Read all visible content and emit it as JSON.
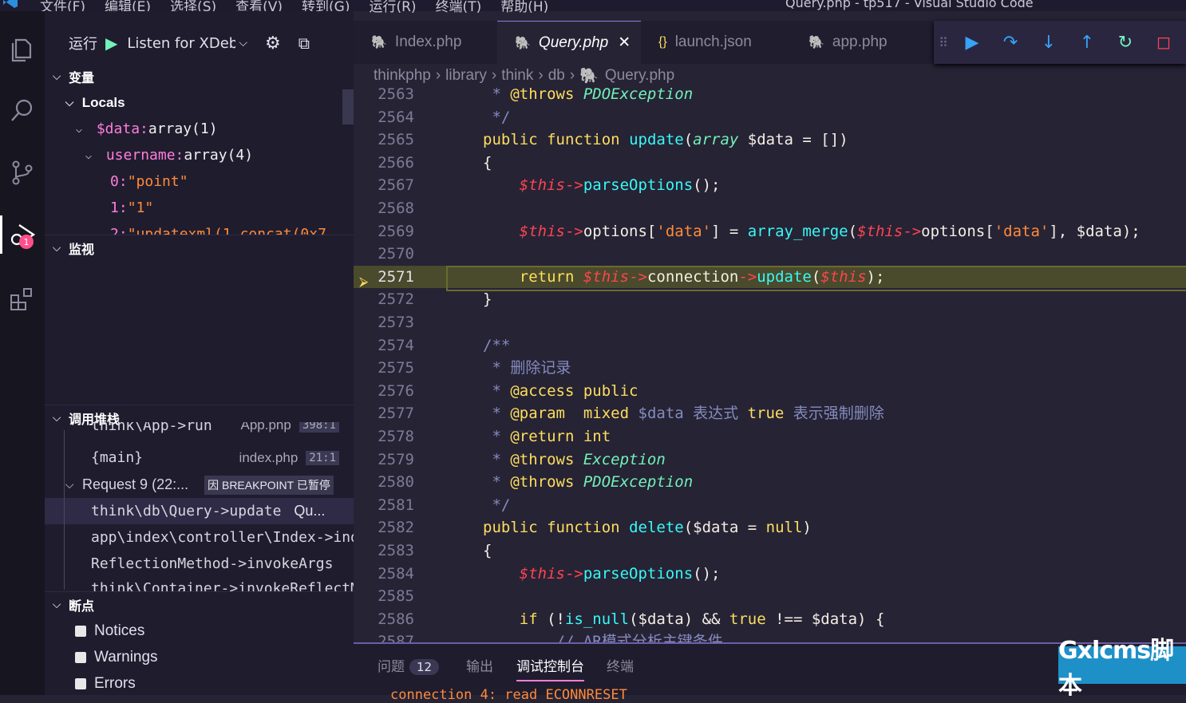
{
  "window": {
    "title": "Query.php - tp517 - Visual Studio Code",
    "menu": [
      "文件(F)",
      "编辑(E)",
      "选择(S)",
      "查看(V)",
      "转到(G)",
      "运行(R)",
      "终端(T)",
      "帮助(H)"
    ]
  },
  "activity": {
    "debug_badge": "1"
  },
  "sidebar": {
    "run_label": "运行",
    "config": "Listen for XDebug",
    "variables_title": "变量",
    "locals_label": "Locals",
    "vars": [
      {
        "name": "$data:",
        "value": " array(1)"
      },
      {
        "name": "username:",
        "value": " array(4)"
      },
      {
        "name": "0:",
        "value": " \"point\""
      },
      {
        "name": "1:",
        "value": " \"1\""
      },
      {
        "name": "2:",
        "value": " \"updatexml(1,concat(0x7..."
      }
    ],
    "watch_title": "监视",
    "callstack_title": "调用堆栈",
    "frames_top": [
      {
        "name": "think\\App->run",
        "file": "App.php",
        "pos": "398:1"
      },
      {
        "name": "{main}",
        "file": "index.php",
        "pos": "21:1"
      }
    ],
    "request_label": "Request 9 (22:...",
    "paused_label": "因 BREAKPOINT 已暂停",
    "frames": [
      {
        "name": "think\\db\\Query->update",
        "file": "Qu..."
      },
      {
        "name": "app\\index\\controller\\Index->index"
      },
      {
        "name": "ReflectionMethod->invokeArgs"
      },
      {
        "name": "think\\Container->invokeReflectMethod"
      }
    ],
    "breakpoints_title": "断点",
    "breakpoints": [
      "Notices",
      "Warnings",
      "Errors"
    ]
  },
  "tabs": [
    {
      "label": "Index.php",
      "icon": "php-icon"
    },
    {
      "label": "Query.php",
      "icon": "php-icon",
      "active": true
    },
    {
      "label": "launch.json",
      "icon": "json-icon"
    },
    {
      "label": "app.php",
      "icon": "php-icon"
    }
  ],
  "breadcrumb": [
    "thinkphp",
    "library",
    "think",
    "db",
    "Query.php"
  ],
  "code": {
    "current_line": "2571",
    "lines": [
      {
        "n": "2563",
        "t": "     * @throws PDOException"
      },
      {
        "n": "2564",
        "t": "     */"
      },
      {
        "n": "2565",
        "t": "    public function update(array $data = [])"
      },
      {
        "n": "2566",
        "t": "    {"
      },
      {
        "n": "2567",
        "t": "        $this->parseOptions();"
      },
      {
        "n": "2568",
        "t": ""
      },
      {
        "n": "2569",
        "t": "        $this->options['data'] = array_merge($this->options['data'], $data);"
      },
      {
        "n": "2570",
        "t": ""
      },
      {
        "n": "2571",
        "t": "        return $this->connection->update($this);"
      },
      {
        "n": "2572",
        "t": "    }"
      },
      {
        "n": "2573",
        "t": ""
      },
      {
        "n": "2574",
        "t": "    /**"
      },
      {
        "n": "2575",
        "t": "     * 删除记录"
      },
      {
        "n": "2576",
        "t": "     * @access public"
      },
      {
        "n": "2577",
        "t": "     * @param  mixed $data 表达式 true 表示强制删除"
      },
      {
        "n": "2578",
        "t": "     * @return int"
      },
      {
        "n": "2579",
        "t": "     * @throws Exception"
      },
      {
        "n": "2580",
        "t": "     * @throws PDOException"
      },
      {
        "n": "2581",
        "t": "     */"
      },
      {
        "n": "2582",
        "t": "    public function delete($data = null)"
      },
      {
        "n": "2583",
        "t": "    {"
      },
      {
        "n": "2584",
        "t": "        $this->parseOptions();"
      },
      {
        "n": "2585",
        "t": ""
      },
      {
        "n": "2586",
        "t": "        if (!is_null($data) && true !== $data) {"
      },
      {
        "n": "2587",
        "t": "            // AR模式分析主键条件"
      }
    ]
  },
  "panel": {
    "tabs": [
      "问题",
      "输出",
      "调试控制台",
      "终端"
    ],
    "problems_count": "12",
    "output_line": "connection 4: read ECONNRESET"
  },
  "watermark": "Gxlcms脚本"
}
